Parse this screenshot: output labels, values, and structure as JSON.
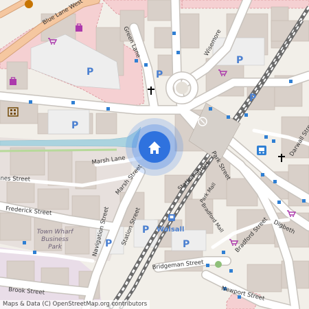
{
  "attribution": "Maps & Data (C) OpenStreetMap.org contributors",
  "streets": {
    "blue_lane_west": "Blue Lane West",
    "green_lane": "Green Lane",
    "wisemore": "Wisemore",
    "marsh_lane_1": "Marsh Lane",
    "marsh_lane_2": "Marsh Lane",
    "marsh_street": "Marsh Street",
    "station_street_1": "Station Street",
    "station_street_2": "Station Street",
    "park_street": "Park Street",
    "park_mall": "Park Mall",
    "bradford_mall": "Bradford Mall",
    "bradford_street": "Bradford Street",
    "digbeth": "Digbeth",
    "darwall_street": "Darwall Street",
    "frederick_street": "Frederick Street",
    "navigation_street": "Navigation Street",
    "bridgeman_street": "Bridgeman Street",
    "brook_street": "Brook Street",
    "newport_street": "Newport Street",
    "ines_street": "ines Street"
  },
  "areas": {
    "town_wharf": "Town Wharf",
    "business": "Business",
    "park": "Park"
  },
  "places": {
    "walsall": "Walsall"
  },
  "parking_glyph": "P",
  "icons": [
    "home-marker-icon",
    "parking-icon",
    "shopping-cart-icon",
    "shopping-bag-icon",
    "church-icon",
    "cinema-icon",
    "bus-station-icon",
    "train-station-icon",
    "fast-food-icon"
  ],
  "colors": {
    "land": "#f2efe9",
    "retail": "#f5d0d2",
    "road": "#ffffff",
    "primary_road": "#f5c7a0",
    "building": "#d9d0c9",
    "water": "#aad3df",
    "rail": "#6b6b6b",
    "marker_halo": "#4a88e8",
    "parking": "#4a7fd0"
  }
}
